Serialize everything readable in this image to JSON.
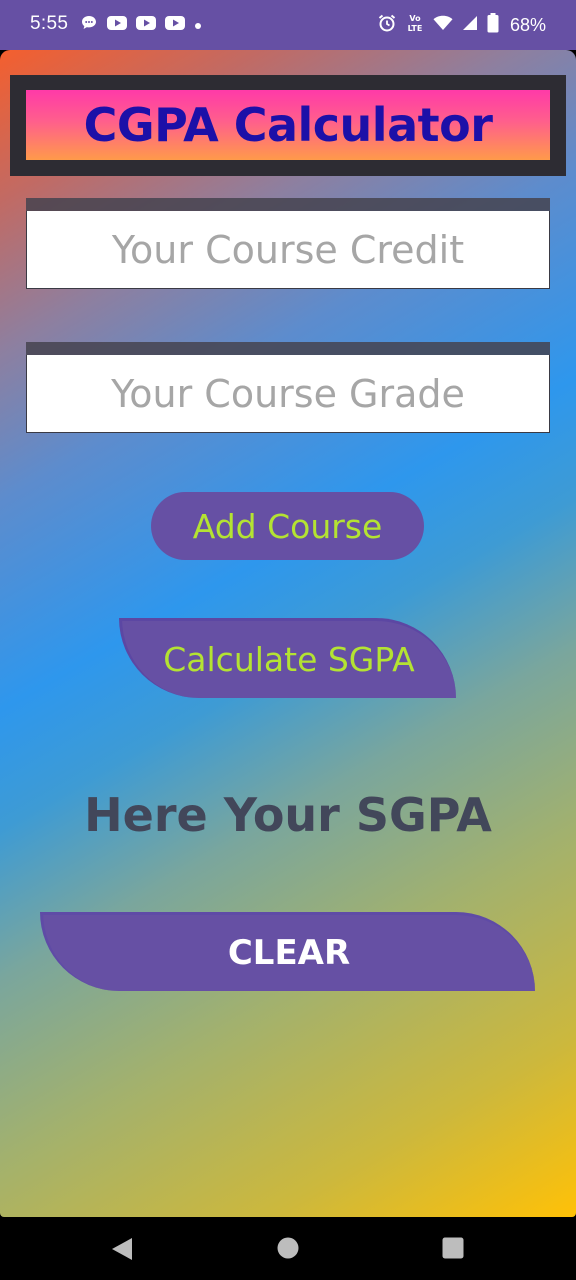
{
  "status_bar": {
    "time": "5:55",
    "left_icons": [
      "chat-bubble-icon",
      "youtube-icon",
      "youtube-icon",
      "youtube-icon",
      "dot-icon"
    ],
    "right_icons": [
      "alarm-icon",
      "volte-icon",
      "wifi-icon",
      "signal-icon",
      "battery-icon"
    ],
    "volte_top": "Vo",
    "volte_bottom": "LTE",
    "battery_percent": "68%"
  },
  "app": {
    "title": "CGPA Calculator",
    "credit_field": {
      "placeholder": "Your Course Credit",
      "value": ""
    },
    "grade_field": {
      "placeholder": "Your Course Grade",
      "value": ""
    },
    "add_button_label": "Add Course",
    "calculate_button_label": "Calculate SGPA",
    "result_text": "Here Your SGPA",
    "clear_button_label": "CLEAR"
  },
  "colors": {
    "status_bar": "#6650a4",
    "button_bg": "#6650a4",
    "button_text": "#b4e332",
    "title_text": "#1c10a8",
    "result_text": "#42475a"
  },
  "nav_bar": {
    "buttons": [
      "back-icon",
      "home-icon",
      "recents-icon"
    ]
  }
}
